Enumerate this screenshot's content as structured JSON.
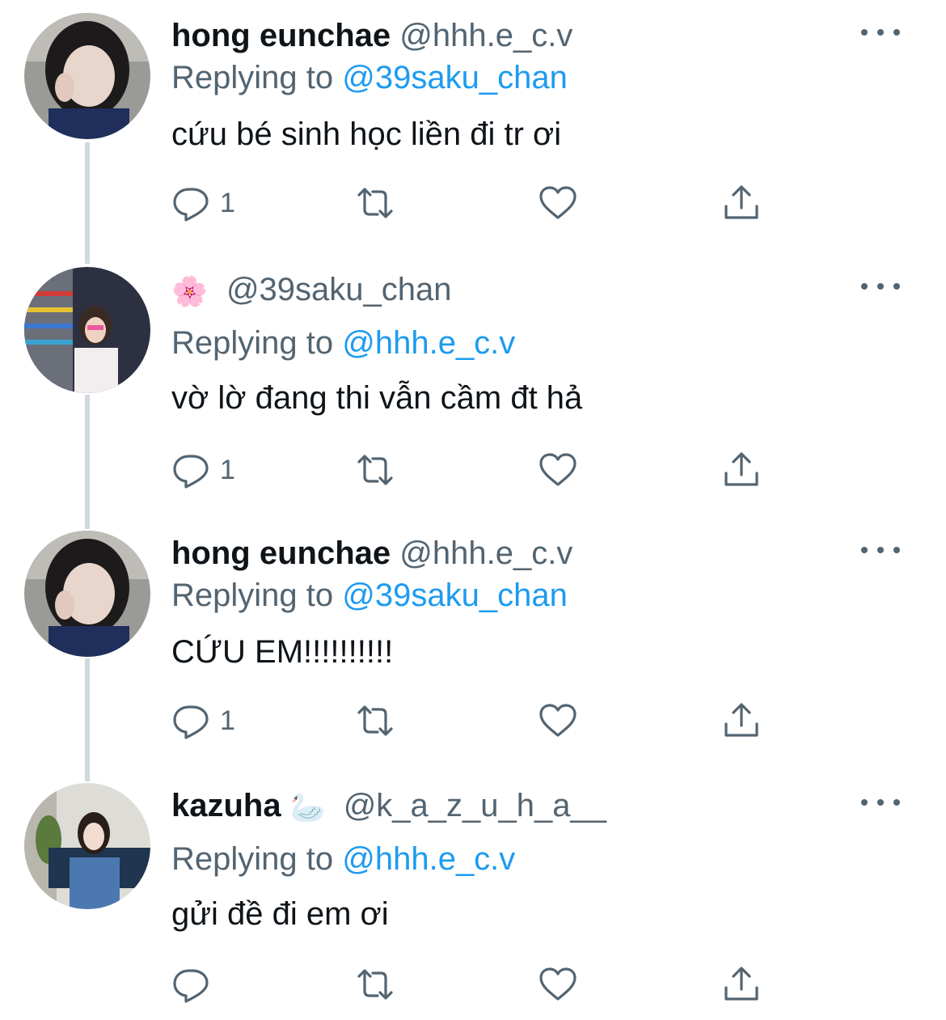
{
  "tweets": [
    {
      "display_name": "hong eunchae",
      "handle": "@hhh.e_c.v",
      "name_emoji": "",
      "replying_prefix": "Replying to ",
      "replying_to": "@39saku_chan",
      "text": "cứu bé sinh học liền đi tr ơi",
      "reply_count": "1",
      "avatar": "portrait-dark-hair-peace-sign"
    },
    {
      "display_name": "",
      "handle": "@39saku_chan",
      "name_emoji": "🌸",
      "replying_prefix": "Replying to ",
      "replying_to": "@hhh.e_c.v",
      "text": "vờ lờ đang thi vẫn cầm đt hả",
      "reply_count": "1",
      "avatar": "street-photo-pink-glasses"
    },
    {
      "display_name": "hong eunchae",
      "handle": "@hhh.e_c.v",
      "name_emoji": "",
      "replying_prefix": "Replying to ",
      "replying_to": "@39saku_chan",
      "text": "CỨU EM!!!!!!!!!!",
      "reply_count": "1",
      "avatar": "portrait-dark-hair-peace-sign"
    },
    {
      "display_name": "kazuha",
      "handle": "@k_a_z_u_h_a__",
      "name_emoji": "🦢",
      "replying_prefix": "Replying to ",
      "replying_to": "@hhh.e_c.v",
      "text": "gửi đề đi em ơi",
      "reply_count": "",
      "avatar": "seated-photo-denim"
    }
  ],
  "icons": {
    "reply": "reply-icon",
    "retweet": "retweet-icon",
    "like": "heart-icon",
    "share": "share-icon",
    "more": "more-options-icon"
  },
  "colors": {
    "text": "#0f1419",
    "secondary": "#536471",
    "link": "#1d9bf0",
    "thread_line": "#cfd9de"
  }
}
